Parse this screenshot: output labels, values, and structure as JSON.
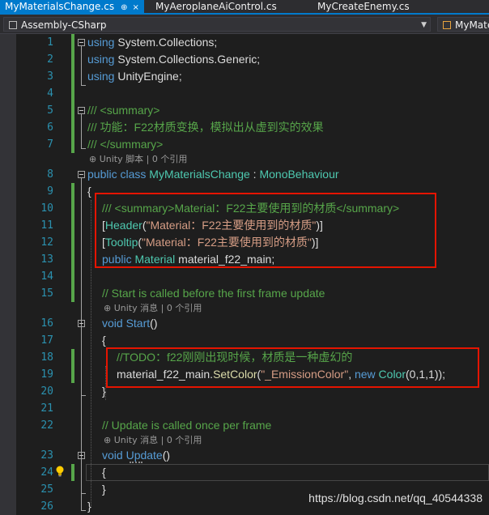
{
  "tabs": [
    {
      "label": "MyMaterialsChange.cs",
      "active": true,
      "pin": "⊕",
      "close": "×"
    },
    {
      "label": "MyAeroplaneAiControl.cs",
      "active": false
    },
    {
      "label": "MyCreateEnemy.cs",
      "active": false
    }
  ],
  "navbar": {
    "project": "Assembly-CSharp",
    "type_scope": "MyMate"
  },
  "line_numbers": [
    "1",
    "2",
    "3",
    "4",
    "5",
    "6",
    "7",
    "8",
    "9",
    "10",
    "11",
    "12",
    "13",
    "14",
    "15",
    "16",
    "17",
    "18",
    "19",
    "20",
    "21",
    "22",
    "23",
    "24",
    "25",
    "26"
  ],
  "code": {
    "l1": {
      "kw": "using",
      "rest": " System.Collections;"
    },
    "l2": {
      "kw": "using",
      "rest": " System.Collections.Generic;"
    },
    "l3": {
      "kw": "using",
      "rest": " UnityEngine;"
    },
    "l5": "/// <summary>",
    "l6": "/// 功能：F22材质变换，模拟出从虚到实的效果",
    "l7": "/// </summary>",
    "lens_class": {
      "icon": "⊕",
      "text": "Unity 脚本",
      "sep": "|",
      "refs": "0 个引用"
    },
    "l8": {
      "kw1": "public",
      "kw2": "class",
      "name": "MyMaterialsChange",
      "colon": " : ",
      "base": "MonoBehaviour"
    },
    "l9": "{",
    "l10": "/// <summary>Material：F22主要使用到的材质</summary>",
    "l11": {
      "open": "[",
      "attr": "Header",
      "lp": "(",
      "str": "\"Material：F22主要使用到的材质\"",
      "rp": ")]"
    },
    "l12": {
      "open": "[",
      "attr": "Tooltip",
      "lp": "(",
      "str": "\"Material：F22主要使用到的材质\"",
      "rp": ")]"
    },
    "l13": {
      "kw": "public",
      "type": "Material",
      "rest": " material_f22_main;"
    },
    "l15": "// Start is called before the first frame update",
    "lens_start": {
      "icon": "⊕",
      "text": "Unity 消息",
      "sep": "|",
      "refs": "0 个引用"
    },
    "l16": {
      "kw": "void",
      "name": "Start",
      "rest": "()"
    },
    "l17": "{",
    "l18": "//TODO：f22刚刚出现时候，材质是一种虚幻的",
    "l19": {
      "a": "material_f22_main.",
      "fn": "SetColor",
      "b": "(",
      "str": "\"_EmissionColor\"",
      "c": ", ",
      "kw": "new",
      "type": "Color",
      "d": "(0,1,1));"
    },
    "l20": "}",
    "l22": "// Update is called once per frame",
    "lens_update": {
      "icon": "⊕",
      "text": "Unity 消息",
      "sep": "|",
      "refs": "0 个引用"
    },
    "l23": {
      "kw": "void",
      "name": "Update",
      "rest": "()"
    },
    "l24": "{",
    "l25": "}",
    "l26": "}"
  },
  "watermark": "https://blog.csdn.net/qq_40544338",
  "colors": {
    "keyword": "#569cd6",
    "type": "#4ec9b0",
    "comment": "#57a64a",
    "string": "#d69d85",
    "line_number": "#2b91af",
    "highlight_box": "#e51400",
    "accent": "#007acc"
  }
}
